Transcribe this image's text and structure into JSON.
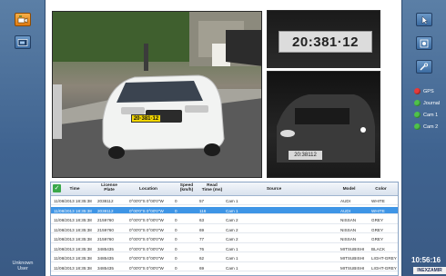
{
  "user": {
    "label_line1": "Unknown",
    "label_line2": "User"
  },
  "left_toolbar": [
    {
      "icon": "camera-open-icon",
      "active": true
    },
    {
      "icon": "camera-window-icon",
      "active": false
    }
  ],
  "right_toolbar": [
    {
      "icon": "cursor-select-icon"
    },
    {
      "icon": "grid-layout-icon"
    },
    {
      "icon": "tools-icon"
    }
  ],
  "status": [
    {
      "label": "GPS",
      "color": "#e53b3b"
    },
    {
      "label": "Journal",
      "color": "#4fc24a"
    },
    {
      "label": "Cam 1",
      "color": "#4fc24a"
    },
    {
      "label": "Cam 2",
      "color": "#4fc24a"
    }
  ],
  "clock": "10:56:16",
  "brand": "INEXZAMIR",
  "plates": {
    "zoom": "20:381·12",
    "night": "20:38112",
    "car": "20·381·12"
  },
  "table": {
    "columns": [
      "Time",
      "License\nPlate",
      "Location",
      "Speed\n(km/h)",
      "Read\nTime (ms)",
      "Source",
      "Model",
      "Color"
    ],
    "rows": [
      [
        "11/08/2013 18:35:38",
        "2038112",
        "0°00'0\"S 0°00'0\"W",
        "0",
        "57",
        "Cam 1",
        "AUDI",
        "WHITE"
      ],
      [
        "11/08/2013 18:35:38",
        "2038112",
        "0°00'0\"S 0°00'0\"W",
        "0",
        "116",
        "Cam 1",
        "AUDI",
        "WHITE"
      ],
      [
        "11/08/2013 18:35:38",
        "2159760",
        "0°00'0\"S 0°00'0\"W",
        "0",
        "63",
        "Cam 2",
        "NISSAN",
        "GREY"
      ],
      [
        "11/08/2013 18:35:38",
        "2159760",
        "0°00'0\"S 0°00'0\"W",
        "0",
        "69",
        "Cam 2",
        "NISSAN",
        "GREY"
      ],
      [
        "11/08/2013 18:35:38",
        "2159760",
        "0°00'0\"S 0°00'0\"W",
        "0",
        "77",
        "Cam 2",
        "NISSAN",
        "GREY"
      ],
      [
        "11/08/2013 18:35:38",
        "3485435",
        "0°00'0\"S 0°00'0\"W",
        "0",
        "76",
        "Cam 1",
        "MITSUBISHI",
        "BLACK"
      ],
      [
        "11/08/2013 18:35:38",
        "3485435",
        "0°00'0\"S 0°00'0\"W",
        "0",
        "62",
        "Cam 1",
        "MITSUBISHI",
        "LIGHT-GREY"
      ],
      [
        "11/08/2013 18:35:38",
        "3485435",
        "0°00'0\"S 0°00'0\"W",
        "0",
        "69",
        "Cam 1",
        "MITSUBISHI",
        "LIGHT-GREY"
      ]
    ],
    "selected_row": 1
  }
}
